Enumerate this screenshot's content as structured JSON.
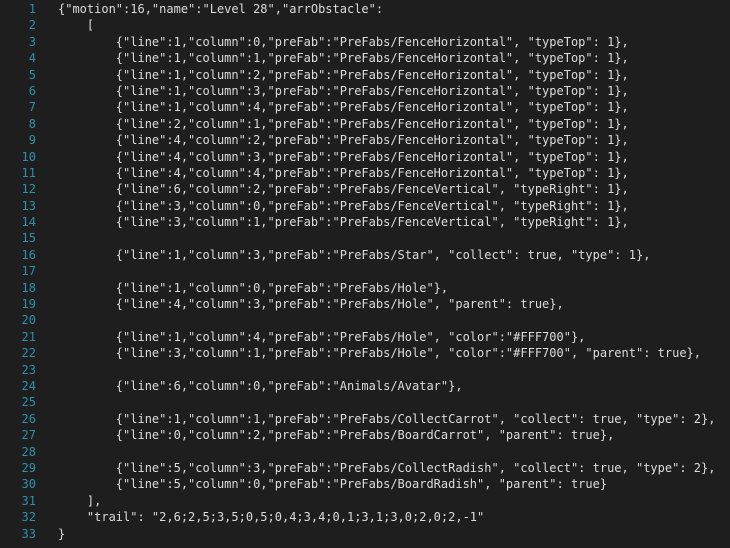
{
  "editor": {
    "lines": [
      {
        "num": "1",
        "text": "{\"motion\":16,\"name\":\"Level 28\",\"arrObstacle\":"
      },
      {
        "num": "2",
        "text": "    ["
      },
      {
        "num": "3",
        "text": "        {\"line\":1,\"column\":0,\"preFab\":\"PreFabs/FenceHorizontal\", \"typeTop\": 1},"
      },
      {
        "num": "4",
        "text": "        {\"line\":1,\"column\":1,\"preFab\":\"PreFabs/FenceHorizontal\", \"typeTop\": 1},"
      },
      {
        "num": "5",
        "text": "        {\"line\":1,\"column\":2,\"preFab\":\"PreFabs/FenceHorizontal\", \"typeTop\": 1},"
      },
      {
        "num": "6",
        "text": "        {\"line\":1,\"column\":3,\"preFab\":\"PreFabs/FenceHorizontal\", \"typeTop\": 1},"
      },
      {
        "num": "7",
        "text": "        {\"line\":1,\"column\":4,\"preFab\":\"PreFabs/FenceHorizontal\", \"typeTop\": 1},"
      },
      {
        "num": "8",
        "text": "        {\"line\":2,\"column\":1,\"preFab\":\"PreFabs/FenceHorizontal\", \"typeTop\": 1},"
      },
      {
        "num": "9",
        "text": "        {\"line\":4,\"column\":2,\"preFab\":\"PreFabs/FenceHorizontal\", \"typeTop\": 1},"
      },
      {
        "num": "10",
        "text": "        {\"line\":4,\"column\":3,\"preFab\":\"PreFabs/FenceHorizontal\", \"typeTop\": 1},"
      },
      {
        "num": "11",
        "text": "        {\"line\":4,\"column\":4,\"preFab\":\"PreFabs/FenceHorizontal\", \"typeTop\": 1},"
      },
      {
        "num": "12",
        "text": "        {\"line\":6,\"column\":2,\"preFab\":\"PreFabs/FenceVertical\", \"typeRight\": 1},"
      },
      {
        "num": "13",
        "text": "        {\"line\":3,\"column\":0,\"preFab\":\"PreFabs/FenceVertical\", \"typeRight\": 1},"
      },
      {
        "num": "14",
        "text": "        {\"line\":3,\"column\":1,\"preFab\":\"PreFabs/FenceVertical\", \"typeRight\": 1},"
      },
      {
        "num": "15",
        "text": ""
      },
      {
        "num": "16",
        "text": "        {\"line\":1,\"column\":3,\"preFab\":\"PreFabs/Star\", \"collect\": true, \"type\": 1},"
      },
      {
        "num": "17",
        "text": ""
      },
      {
        "num": "18",
        "text": "        {\"line\":1,\"column\":0,\"preFab\":\"PreFabs/Hole\"},"
      },
      {
        "num": "19",
        "text": "        {\"line\":4,\"column\":3,\"preFab\":\"PreFabs/Hole\", \"parent\": true},"
      },
      {
        "num": "20",
        "text": ""
      },
      {
        "num": "21",
        "text": "        {\"line\":1,\"column\":4,\"preFab\":\"PreFabs/Hole\", \"color\":\"#FFF700\"},"
      },
      {
        "num": "22",
        "text": "        {\"line\":3,\"column\":1,\"preFab\":\"PreFabs/Hole\", \"color\":\"#FFF700\", \"parent\": true},"
      },
      {
        "num": "23",
        "text": ""
      },
      {
        "num": "24",
        "text": "        {\"line\":6,\"column\":0,\"preFab\":\"Animals/Avatar\"},"
      },
      {
        "num": "25",
        "text": ""
      },
      {
        "num": "26",
        "text": "        {\"line\":1,\"column\":1,\"preFab\":\"PreFabs/CollectCarrot\", \"collect\": true, \"type\": 2},"
      },
      {
        "num": "27",
        "text": "        {\"line\":0,\"column\":2,\"preFab\":\"PreFabs/BoardCarrot\", \"parent\": true},"
      },
      {
        "num": "28",
        "text": ""
      },
      {
        "num": "29",
        "text": "        {\"line\":5,\"column\":3,\"preFab\":\"PreFabs/CollectRadish\", \"collect\": true, \"type\": 2},"
      },
      {
        "num": "30",
        "text": "        {\"line\":5,\"column\":0,\"preFab\":\"PreFabs/BoardRadish\", \"parent\": true}"
      },
      {
        "num": "31",
        "text": "    ],"
      },
      {
        "num": "32",
        "text": "    \"trail\": \"2,6;2,5;3,5;0,5;0,4;3,4;0,1;3,1;3,0;2,0;2,-1\""
      },
      {
        "num": "33",
        "text": "}"
      }
    ]
  },
  "colors": {
    "background": "#1e1e1e",
    "text": "#dcdcdc",
    "line_number": "#2b91af"
  }
}
